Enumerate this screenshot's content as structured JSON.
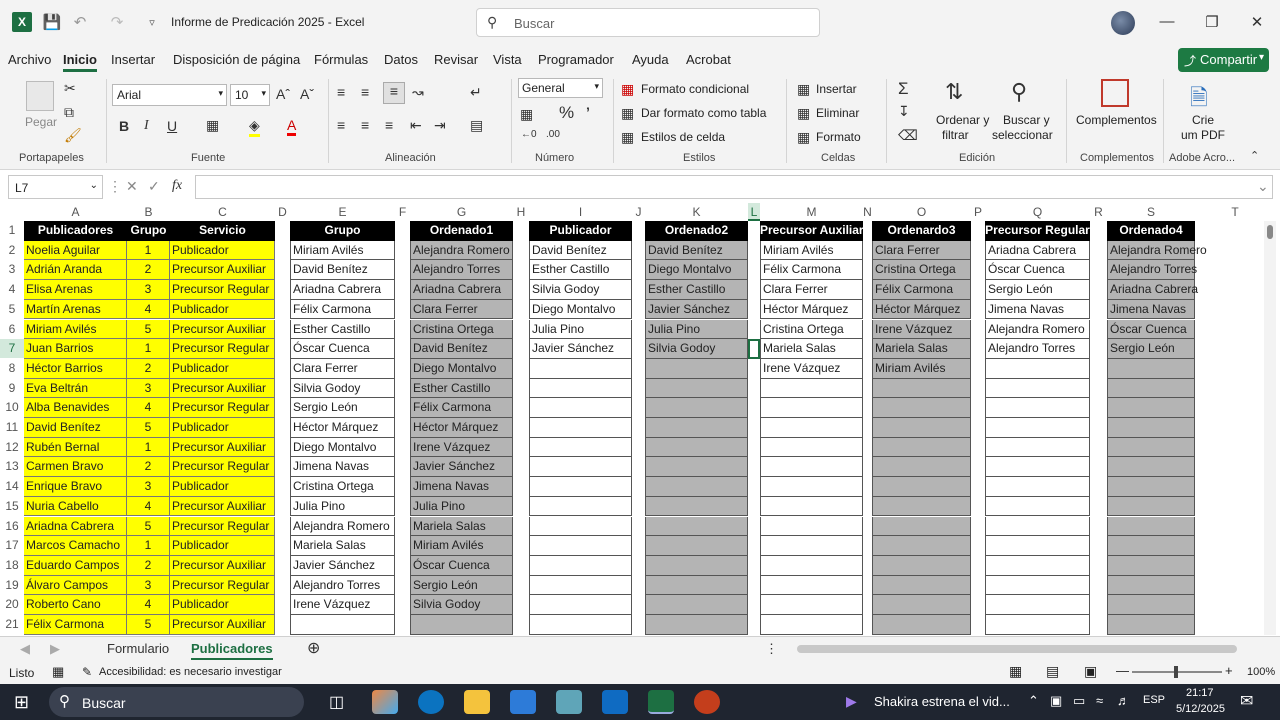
{
  "window": {
    "title": "Informe de Predicación 2025  -  Excel",
    "search_placeholder": "Buscar"
  },
  "menu": {
    "items": [
      "Archivo",
      "Inicio",
      "Insertar",
      "Disposición de página",
      "Fórmulas",
      "Datos",
      "Revisar",
      "Vista",
      "Programador",
      "Ayuda",
      "Acrobat"
    ],
    "active": "Inicio",
    "share_label": "Compartir"
  },
  "ribbon": {
    "clipboard": {
      "paste": "Pegar",
      "group": "Portapapeles"
    },
    "font": {
      "name": "Arial",
      "size": "10",
      "group": "Fuente"
    },
    "alignment": {
      "group": "Alineación"
    },
    "number": {
      "format": "General",
      "group": "Número"
    },
    "styles": {
      "conditional": "Formato condicional",
      "as_table": "Dar formato como tabla",
      "cell_styles": "Estilos de celda",
      "group": "Estilos"
    },
    "cells": {
      "insert": "Insertar",
      "delete": "Eliminar",
      "format": "Formato",
      "group": "Celdas"
    },
    "editing": {
      "sort": "Ordenar y",
      "sort2": "filtrar",
      "find": "Buscar y",
      "find2": "seleccionar",
      "group": "Edición"
    },
    "addins": {
      "label": "Complementos",
      "group": "Complementos"
    },
    "acrobat": {
      "label1": "Crie",
      "label2": "um PDF",
      "group": "Adobe Acro..."
    }
  },
  "formula_bar": {
    "name_box": "L7",
    "formula": ""
  },
  "columns": [
    "A",
    "B",
    "C",
    "D",
    "E",
    "F",
    "G",
    "H",
    "I",
    "J",
    "K",
    "L",
    "M",
    "N",
    "O",
    "P",
    "Q",
    "R",
    "S",
    "T"
  ],
  "headers": {
    "A": "Publicadores",
    "B": "Grupo",
    "C": "Servicio",
    "E": "Grupo",
    "G": "Ordenado1",
    "I": "Publicador",
    "K": "Ordenado2",
    "M": "Precursor Auxiliar",
    "O": "Ordenardo3",
    "Q": "Precursor Regular",
    "S": "Ordenado4"
  },
  "rows": {
    "A": [
      "Noelia Aguilar",
      "Adrián Aranda",
      "Elisa Arenas",
      "Martín Arenas",
      "Miriam Avilés",
      "Juan Barrios",
      "Héctor Barrios",
      "Eva Beltrán",
      "Alba Benavides",
      "David Benítez",
      "Rubén Bernal",
      "Carmen Bravo",
      "Enrique Bravo",
      "Nuria Cabello",
      "Ariadna Cabrera",
      "Marcos Camacho",
      "Eduardo Campos",
      "Álvaro Campos",
      "Roberto Cano",
      "Félix Carmona"
    ],
    "B": [
      "1",
      "2",
      "3",
      "4",
      "5",
      "1",
      "2",
      "3",
      "4",
      "5",
      "1",
      "2",
      "3",
      "4",
      "5",
      "1",
      "2",
      "3",
      "4",
      "5"
    ],
    "C": [
      "Publicador",
      "Precursor Auxiliar",
      "Precursor Regular",
      "Publicador",
      "Precursor Auxiliar",
      "Precursor Regular",
      "Publicador",
      "Precursor Auxiliar",
      "Precursor Regular",
      "Publicador",
      "Precursor Auxiliar",
      "Precursor Regular",
      "Publicador",
      "Precursor Auxiliar",
      "Precursor Regular",
      "Publicador",
      "Precursor Auxiliar",
      "Precursor Regular",
      "Publicador",
      "Precursor Auxiliar"
    ],
    "E": [
      "Miriam Avilés",
      "David Benítez",
      "Ariadna Cabrera",
      "Félix Carmona",
      "Esther Castillo",
      "Óscar Cuenca",
      "Clara Ferrer",
      "Silvia Godoy",
      "Sergio León",
      "Héctor Márquez",
      "Diego Montalvo",
      "Jimena Navas",
      "Cristina Ortega",
      "Julia Pino",
      "Alejandra Romero",
      "Mariela Salas",
      "Javier Sánchez",
      "Alejandro Torres",
      "Irene Vázquez",
      ""
    ],
    "G": [
      "Alejandra Romero",
      "Alejandro Torres",
      "Ariadna Cabrera",
      "Clara Ferrer",
      "Cristina Ortega",
      "David Benítez",
      "Diego Montalvo",
      "Esther Castillo",
      "Félix Carmona",
      "Héctor Márquez",
      "Irene Vázquez",
      "Javier Sánchez",
      "Jimena Navas",
      "Julia Pino",
      "Mariela Salas",
      "Miriam Avilés",
      "Óscar Cuenca",
      "Sergio León",
      "Silvia Godoy",
      ""
    ],
    "I": [
      "David Benítez",
      "Esther Castillo",
      "Silvia Godoy",
      "Diego Montalvo",
      "Julia Pino",
      "Javier Sánchez",
      "",
      "",
      "",
      "",
      "",
      "",
      "",
      "",
      "",
      "",
      "",
      "",
      "",
      ""
    ],
    "K": [
      "David Benítez",
      "Diego Montalvo",
      "Esther Castillo",
      "Javier Sánchez",
      "Julia Pino",
      "Silvia Godoy",
      "",
      "",
      "",
      "",
      "",
      "",
      "",
      "",
      "",
      "",
      "",
      "",
      "",
      ""
    ],
    "M": [
      "Miriam Avilés",
      "Félix Carmona",
      "Clara Ferrer",
      "Héctor Márquez",
      "Cristina Ortega",
      "Mariela Salas",
      "Irene Vázquez",
      "",
      "",
      "",
      "",
      "",
      "",
      "",
      "",
      "",
      "",
      "",
      "",
      ""
    ],
    "O": [
      "Clara Ferrer",
      "Cristina Ortega",
      "Félix Carmona",
      "Héctor Márquez",
      "Irene Vázquez",
      "Mariela Salas",
      "Miriam Avilés",
      "",
      "",
      "",
      "",
      "",
      "",
      "",
      "",
      "",
      "",
      "",
      "",
      ""
    ],
    "Q": [
      "Ariadna Cabrera",
      "Óscar Cuenca",
      "Sergio León",
      "Jimena Navas",
      "Alejandra Romero",
      "Alejandro Torres",
      "",
      "",
      "",
      "",
      "",
      "",
      "",
      "",
      "",
      "",
      "",
      "",
      "",
      ""
    ],
    "S": [
      "Alejandra Romero",
      "Alejandro Torres",
      "Ariadna Cabrera",
      "Jimena Navas",
      "Óscar Cuenca",
      "Sergio León",
      "",
      "",
      "",
      "",
      "",
      "",
      "",
      "",
      "",
      "",
      "",
      "",
      "",
      ""
    ]
  },
  "sheets": [
    "Formulario",
    "Publicadores"
  ],
  "active_sheet": "Publicadores",
  "status": {
    "ready": "Listo",
    "accessibility": "Accesibilidad: es necesario investigar",
    "zoom": "100%"
  },
  "taskbar": {
    "search": "Buscar",
    "news": "Shakira estrena el vid...",
    "lang": "ESP",
    "time": "21:17",
    "date": "5/12/2025"
  },
  "colors": {
    "excel_green": "#1d6f42",
    "yellow": "#ffff00",
    "gray_fill": "#b4b4b4",
    "header_black": "#000000"
  }
}
